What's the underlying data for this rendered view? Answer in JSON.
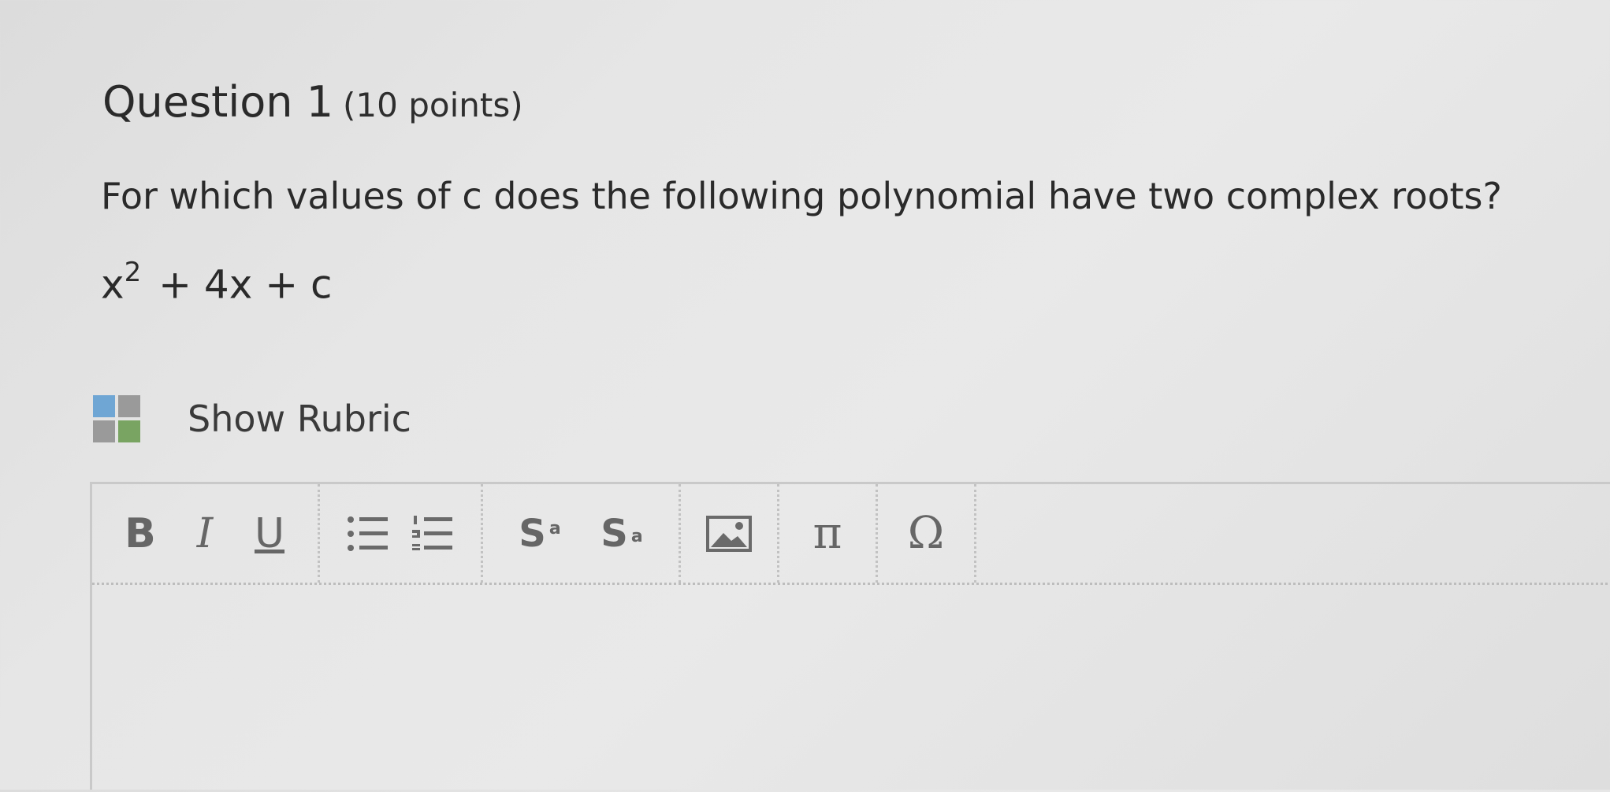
{
  "question": {
    "title": "Question 1",
    "points": "(10 points)",
    "prompt": "For which values of c does the following polynomial have two complex roots?",
    "polynomial": {
      "base": "x",
      "exponent": "2",
      "rest": "+ 4x + c"
    }
  },
  "rubric": {
    "label": "Show Rubric"
  },
  "toolbar": {
    "bold": "B",
    "italic": "I",
    "underline": "U",
    "superscript_base": "S",
    "superscript_mark": "a",
    "subscript_base": "S",
    "subscript_mark": "a",
    "pi": "π",
    "omega": "Ω"
  },
  "icons": [
    "rubric-icon",
    "bullet-list-icon",
    "numbered-list-icon",
    "image-icon"
  ]
}
